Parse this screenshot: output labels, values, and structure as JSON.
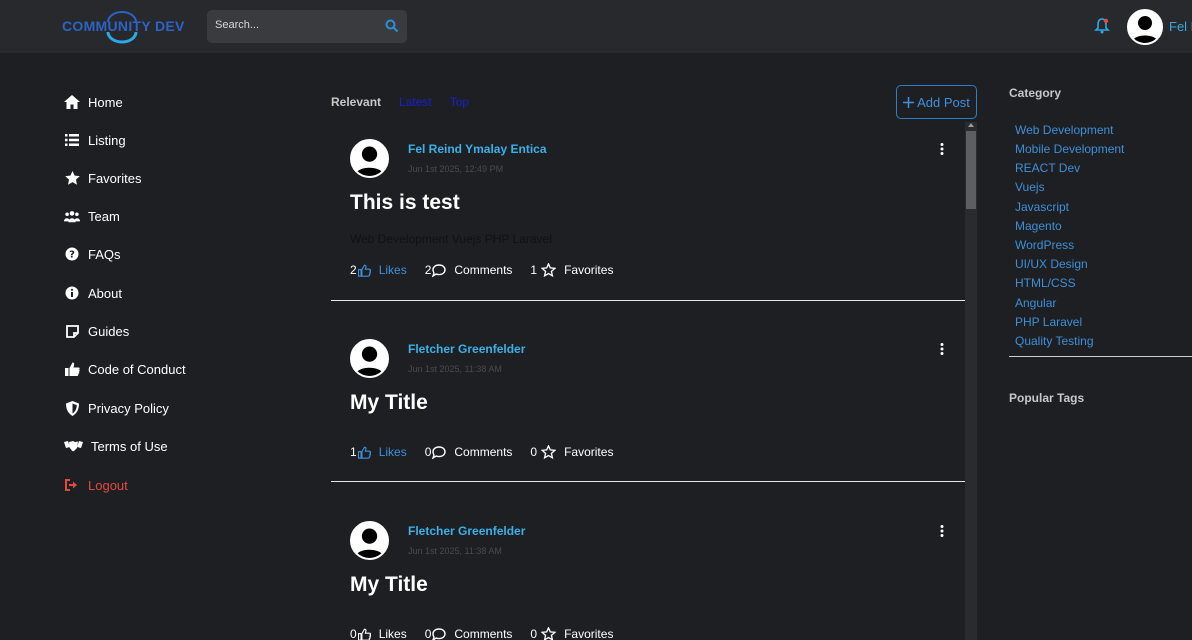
{
  "header": {
    "logo_text": "COMMUNITY DEV",
    "search_placeholder": "Search...",
    "user_name": "Fel R"
  },
  "sidebar": {
    "items": [
      {
        "label": "Home",
        "icon": "home-icon"
      },
      {
        "label": "Listing",
        "icon": "list-icon"
      },
      {
        "label": "Favorites",
        "icon": "star-icon"
      },
      {
        "label": "Team",
        "icon": "users-icon"
      },
      {
        "label": "FAQs",
        "icon": "question-icon"
      },
      {
        "label": "About",
        "icon": "info-icon"
      },
      {
        "label": "Guides",
        "icon": "note-icon"
      },
      {
        "label": "Code of Conduct",
        "icon": "thumbs-up-icon"
      },
      {
        "label": "Privacy Policy",
        "icon": "shield-icon"
      },
      {
        "label": "Terms of Use",
        "icon": "handshake-icon"
      },
      {
        "label": "Logout",
        "icon": "logout-icon"
      }
    ]
  },
  "feed": {
    "tabs": [
      "Relevant",
      "Latest",
      "Top"
    ],
    "active_tab": "Relevant",
    "add_post_label": "Add Post",
    "likes_label": "Likes",
    "comments_label": "Comments",
    "favorites_label": "Favorites",
    "posts": [
      {
        "author": "Fel Reind Ymalay Entica",
        "date": "Jun 1st 2025, 12:49 PM",
        "title": "This is test",
        "tags": "Web Development Vuejs PHP Laravel",
        "likes": "2",
        "comments": "2",
        "favorites": "1"
      },
      {
        "author": "Fletcher Greenfelder",
        "date": "Jun 1st 2025, 11:38 AM",
        "title": "My Title",
        "tags": "",
        "likes": "1",
        "comments": "0",
        "favorites": "0"
      },
      {
        "author": "Fletcher Greenfelder",
        "date": "Jun 1st 2025, 11:38 AM",
        "title": "My Title",
        "tags": "",
        "likes": "0",
        "comments": "0",
        "favorites": "0"
      }
    ]
  },
  "right_sidebar": {
    "category_heading": "Category",
    "categories": [
      "Web Development",
      "Mobile Development",
      "REACT Dev",
      "Vuejs",
      "Javascript",
      "Magento",
      "WordPress",
      "UI/UX Design",
      "HTML/CSS",
      "Angular",
      "PHP Laravel",
      "Quality Testing"
    ],
    "tags_heading": "Popular Tags"
  },
  "colors": {
    "accent": "#3d91db",
    "author": "#3ab1e8",
    "logout": "#e04a3f",
    "background": "#1e1f23"
  }
}
